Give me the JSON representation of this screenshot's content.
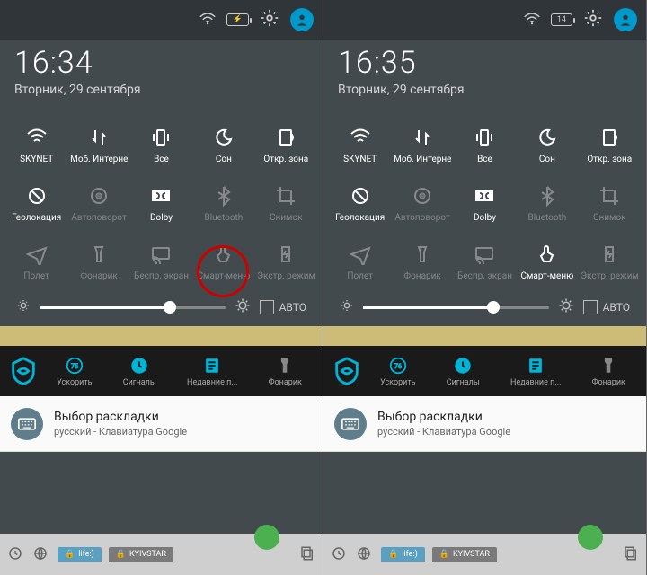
{
  "left": {
    "status": {
      "battery": "⚡"
    },
    "time": "16:34",
    "date": "Вторник, 29 сентября",
    "tiles_row1": [
      {
        "label": "SKYNET",
        "state": "active",
        "icon": "wifi"
      },
      {
        "label": "Моб. Интернет",
        "state": "active",
        "icon": "updown"
      },
      {
        "label": "Все",
        "state": "active",
        "icon": "vibrate"
      },
      {
        "label": "Сон",
        "state": "active",
        "icon": "moon"
      },
      {
        "label": "Откр. зона",
        "state": "active",
        "icon": "hotspot"
      }
    ],
    "tiles_row2": [
      {
        "label": "Геолокация",
        "state": "active",
        "icon": "geo"
      },
      {
        "label": "Автоповорот",
        "state": "inactive",
        "icon": "rotate"
      },
      {
        "label": "Dolby",
        "state": "active",
        "icon": "dolby"
      },
      {
        "label": "Bluetooth",
        "state": "inactive",
        "icon": "bt"
      },
      {
        "label": "Снимок",
        "state": "inactive",
        "icon": "crop"
      }
    ],
    "tiles_row3": [
      {
        "label": "Полет",
        "state": "inactive",
        "icon": "plane"
      },
      {
        "label": "Фонарик",
        "state": "inactive",
        "icon": "torch"
      },
      {
        "label": "Беспр. экран",
        "state": "inactive",
        "icon": "cast"
      },
      {
        "label": "Смарт-меню",
        "state": "inactive",
        "icon": "touch"
      },
      {
        "label": "Экстр. режим",
        "state": "inactive",
        "icon": "power"
      }
    ],
    "brightness_pct": 70,
    "auto_label": "АВТО",
    "toolbar": {
      "speed_val": "75",
      "items": [
        {
          "label": "Ускорить"
        },
        {
          "label": "Сигналы"
        },
        {
          "label": "Недавние п..."
        },
        {
          "label": "Фонарик"
        }
      ]
    },
    "notif": {
      "title": "Выбор раскладки",
      "subtitle": "русский - Клавиатура Google"
    },
    "tabs": [
      "life:)",
      "KYIVSTAR"
    ],
    "highlight_smartmenu": true
  },
  "right": {
    "status": {
      "battery": "14"
    },
    "time": "16:35",
    "date": "Вторник, 29 сентября",
    "tiles_row1": [
      {
        "label": "SKYNET",
        "state": "active",
        "icon": "wifi"
      },
      {
        "label": "Моб. Интернет",
        "state": "active",
        "icon": "updown"
      },
      {
        "label": "Все",
        "state": "active",
        "icon": "vibrate"
      },
      {
        "label": "Сон",
        "state": "active",
        "icon": "moon"
      },
      {
        "label": "Откр. зона",
        "state": "active",
        "icon": "hotspot"
      }
    ],
    "tiles_row2": [
      {
        "label": "Геолокация",
        "state": "active",
        "icon": "geo"
      },
      {
        "label": "Автоповорот",
        "state": "inactive",
        "icon": "rotate"
      },
      {
        "label": "Dolby",
        "state": "active",
        "icon": "dolby"
      },
      {
        "label": "Bluetooth",
        "state": "inactive",
        "icon": "bt"
      },
      {
        "label": "Снимок",
        "state": "inactive",
        "icon": "crop"
      }
    ],
    "tiles_row3": [
      {
        "label": "Полет",
        "state": "inactive",
        "icon": "plane"
      },
      {
        "label": "Фонарик",
        "state": "inactive",
        "icon": "torch"
      },
      {
        "label": "Беспр. экран",
        "state": "inactive",
        "icon": "cast"
      },
      {
        "label": "Смарт-меню",
        "state": "active",
        "icon": "touch"
      },
      {
        "label": "Экстр. режим",
        "state": "inactive",
        "icon": "power"
      }
    ],
    "brightness_pct": 70,
    "auto_label": "АВТО",
    "toolbar": {
      "speed_val": "76",
      "items": [
        {
          "label": "Ускорить"
        },
        {
          "label": "Сигналы"
        },
        {
          "label": "Недавние п..."
        },
        {
          "label": "Фонарик"
        }
      ]
    },
    "notif": {
      "title": "Выбор раскладки",
      "subtitle": "русский - Клавиатура Google"
    },
    "tabs": [
      "life:)",
      "KYIVSTAR"
    ],
    "highlight_smartmenu": false
  }
}
